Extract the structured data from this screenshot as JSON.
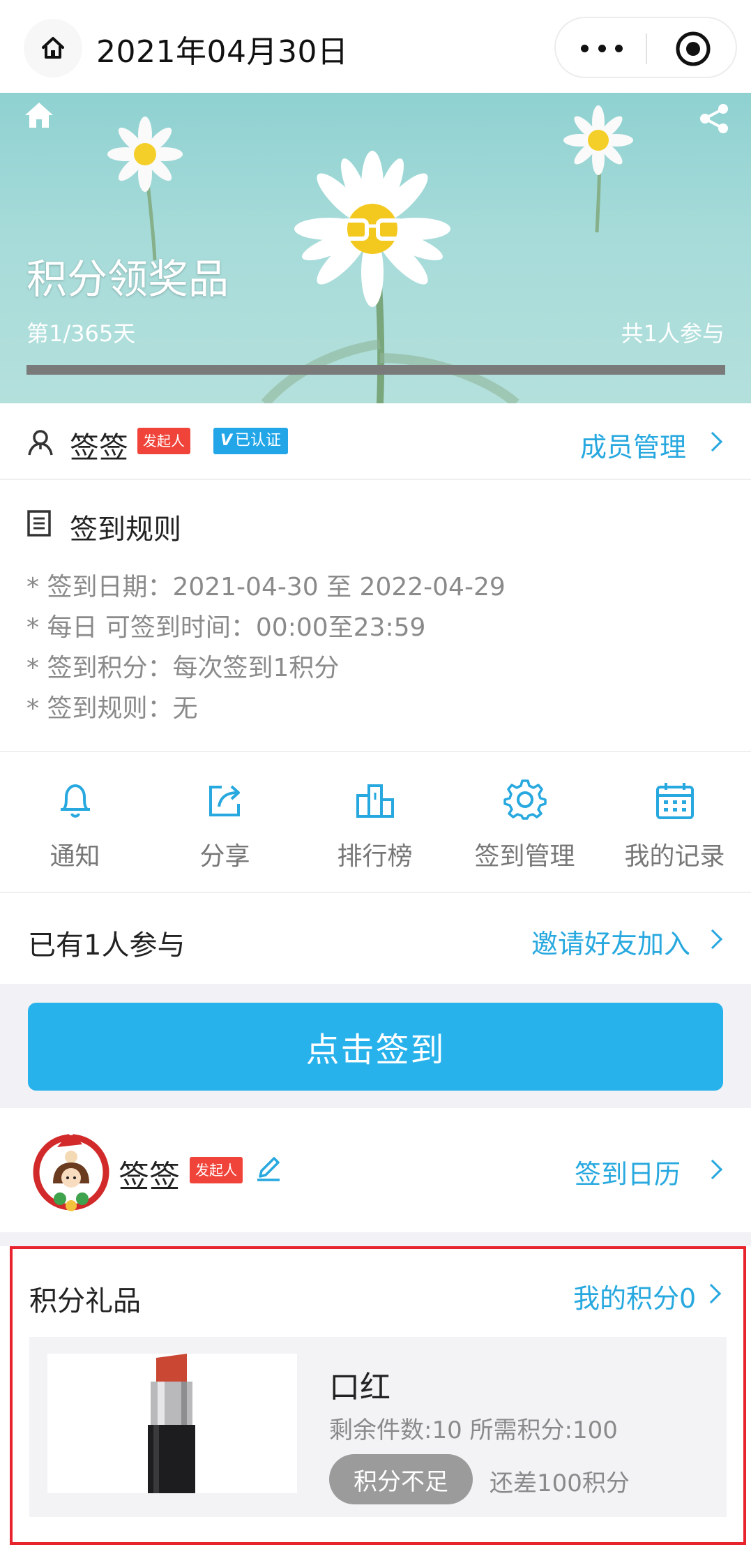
{
  "topbar": {
    "title": "2021年04月30日"
  },
  "banner": {
    "title": "积分领奖品",
    "day": "第1/365天",
    "participants": "共1人参与"
  },
  "owner": {
    "name": "签签",
    "initiator_badge": "发起人",
    "verified_badge": "已认证",
    "verified_mark": "V",
    "member_manage": "成员管理"
  },
  "rules": {
    "title": "签到规则",
    "lines": [
      "* 签到日期：2021-04-30 至 2022-04-29",
      "* 每日 可签到时间：00:00至23:59",
      "* 签到积分：每次签到1积分",
      "* 签到规则：无"
    ]
  },
  "actions": [
    {
      "label": "通知",
      "icon": "bell-icon"
    },
    {
      "label": "分享",
      "icon": "share-icon"
    },
    {
      "label": "排行榜",
      "icon": "ranking-icon"
    },
    {
      "label": "签到管理",
      "icon": "gear-icon"
    },
    {
      "label": "我的记录",
      "icon": "calendar-icon"
    }
  ],
  "participants": {
    "text": "已有1人参与",
    "invite": "邀请好友加入"
  },
  "checkin": {
    "button": "点击签到"
  },
  "user": {
    "name": "签签",
    "badge": "发起人",
    "calendar_link": "签到日历"
  },
  "gifts": {
    "title": "积分礼品",
    "my_points": "我的积分0",
    "items": [
      {
        "name": "口红",
        "meta": "剩余件数:10 所需积分:100",
        "status": "积分不足",
        "diff": "还差100积分"
      }
    ]
  },
  "colors": {
    "accent": "#27b2ec",
    "badge_red": "#f0443a",
    "highlight_border": "#e8232e"
  }
}
